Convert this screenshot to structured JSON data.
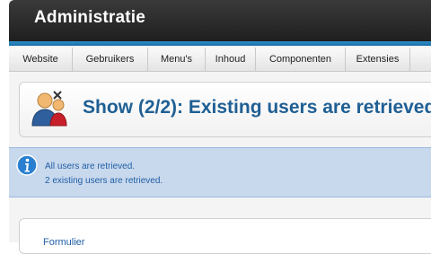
{
  "header": {
    "title": "Administratie"
  },
  "menu": {
    "items": [
      {
        "label": "Website"
      },
      {
        "label": "Gebruikers"
      },
      {
        "label": "Menu's"
      },
      {
        "label": "Inhoud"
      },
      {
        "label": "Componenten"
      },
      {
        "label": "Extensies"
      }
    ]
  },
  "toolbar": {
    "title": "Show (2/2): Existing users are retrieved",
    "icon": "users-icon"
  },
  "message": {
    "icon": "info-icon",
    "lines": [
      "All users are retrieved.",
      "2 existing users are retrieved."
    ],
    "color": "#1f5fa4"
  },
  "content": {
    "label": "Formulier"
  },
  "colors": {
    "header": "#2a2a2a",
    "accent": "#1a6fa8",
    "title": "#1f5f94",
    "message_bg": "#c8d8ed"
  }
}
